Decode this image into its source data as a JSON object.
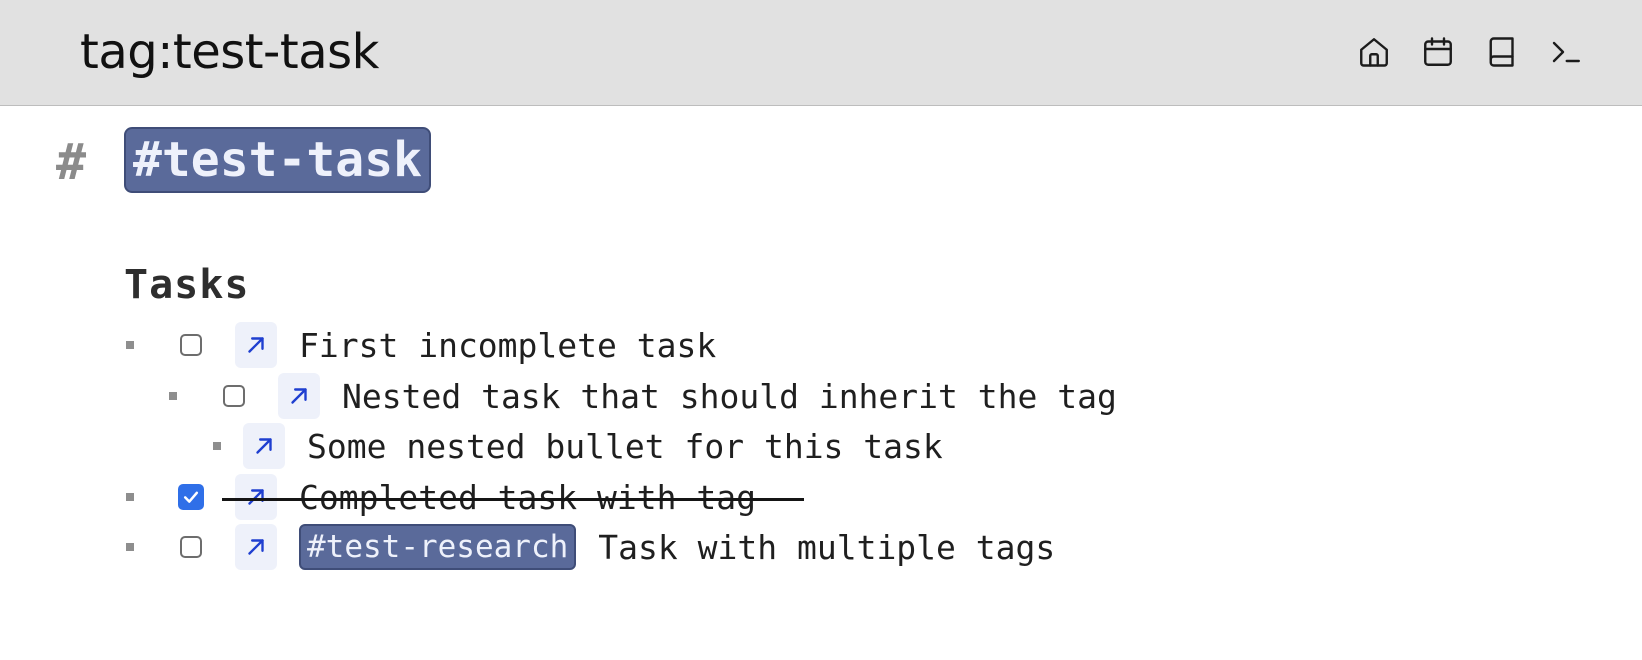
{
  "header": {
    "title": "tag:test-task",
    "icons": [
      "home-icon",
      "calendar-icon",
      "book-icon",
      "terminal-icon"
    ]
  },
  "heading": {
    "hash": "#",
    "tag": "#test-task"
  },
  "section": {
    "title": "Tasks"
  },
  "tasks": [
    {
      "text": "First incomplete task",
      "checked": false,
      "has_checkbox": true,
      "level": 0
    },
    {
      "text": "Nested task that should inherit the tag",
      "checked": false,
      "has_checkbox": true,
      "level": 1
    },
    {
      "text": "Some nested bullet for this task",
      "checked": false,
      "has_checkbox": false,
      "level": 2
    },
    {
      "text": "Completed task with tag",
      "checked": true,
      "has_checkbox": true,
      "level": 0
    },
    {
      "tag": "#test-research",
      "text": "Task with multiple tags",
      "checked": false,
      "has_checkbox": true,
      "level": 0
    }
  ],
  "colors": {
    "header_bg": "#e1e1e1",
    "tag_bg": "#5a6a9a",
    "tag_text": "#eef1fb",
    "link_bg": "#eef1fa",
    "link_arrow": "#1f3fd0",
    "checkbox_checked": "#2f6fe8"
  }
}
